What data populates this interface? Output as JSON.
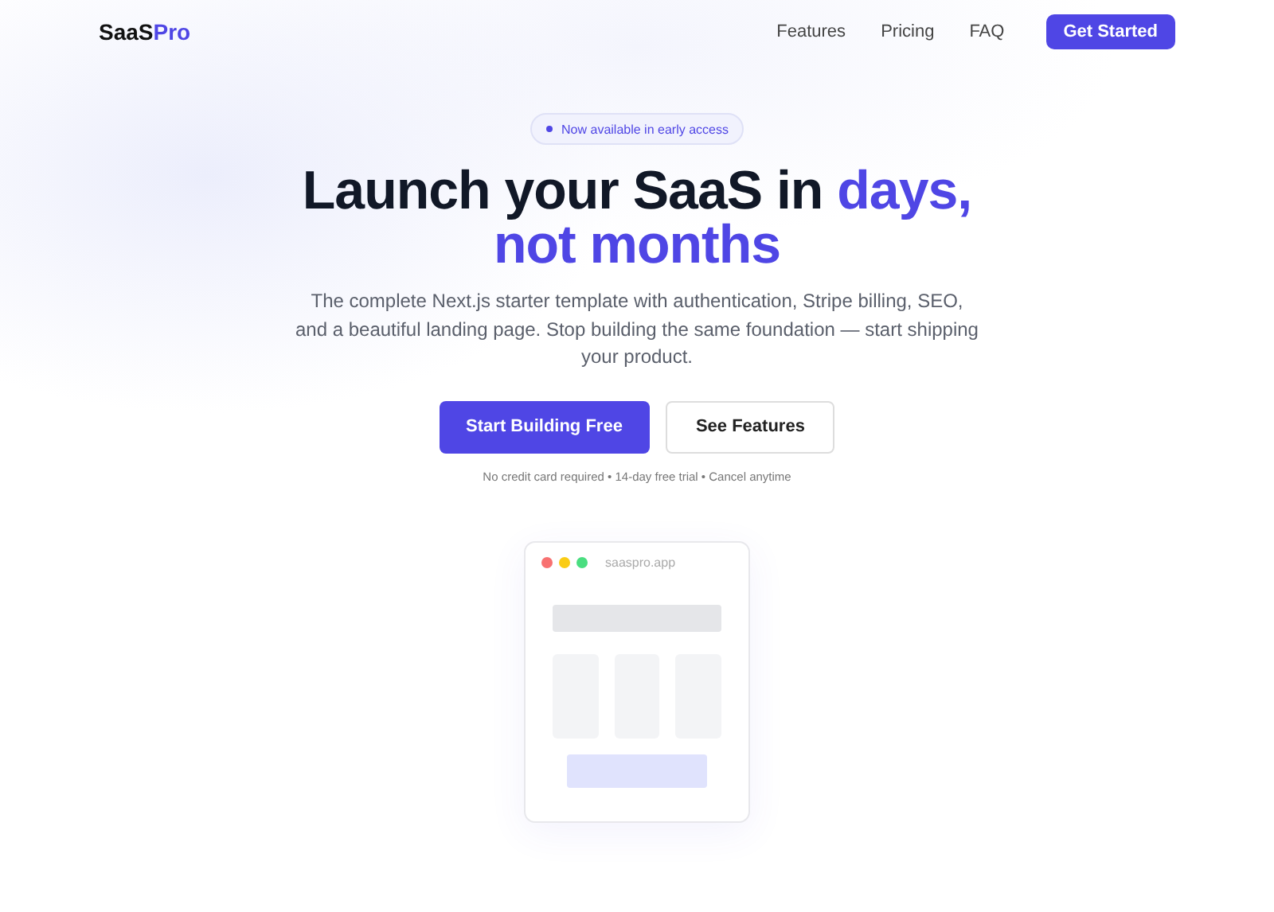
{
  "logo": {
    "text": "SaaS",
    "accent": "Pro"
  },
  "nav": {
    "links": [
      "Features",
      "Pricing",
      "FAQ"
    ],
    "cta": "Get Started"
  },
  "hero": {
    "badge": "Now available in early access",
    "headline": "Launch your SaaS in",
    "headline_accent_1": "days,",
    "headline_accent_2": "not months",
    "description": "The complete Next.js starter template with authentication, Stripe billing, SEO, and a beautiful landing page. Stop building the same foundation — start shipping your product.",
    "buttons": [
      {
        "label": "Start Building Free",
        "kind": "primary"
      },
      {
        "label": "See Features",
        "kind": "secondary"
      }
    ],
    "note": "No credit card required • 14-day free trial • Cancel anytime"
  },
  "preview": {
    "url": "saaspro.app",
    "dots": [
      {
        "color": "#f87171"
      },
      {
        "color": "#facc15"
      },
      {
        "color": "#4ade80"
      }
    ]
  }
}
